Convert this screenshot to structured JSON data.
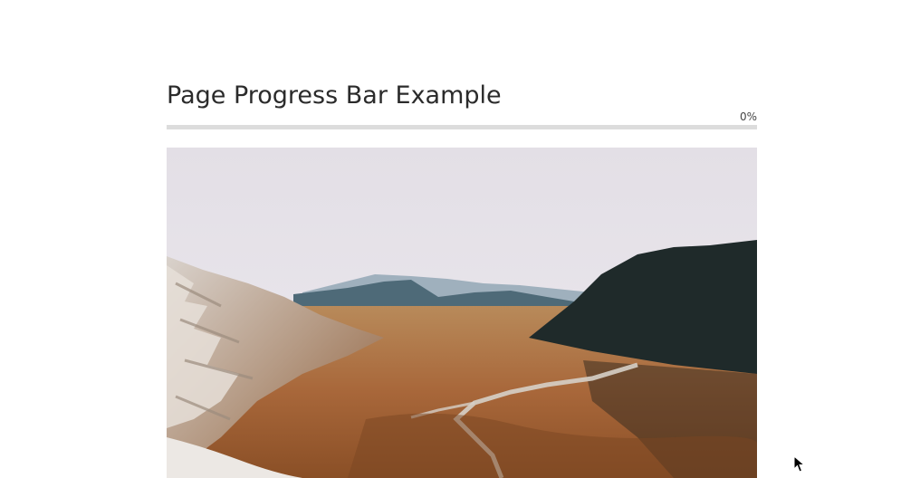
{
  "page": {
    "title": "Page Progress Bar Example"
  },
  "progress": {
    "label": "0%",
    "value": 0,
    "fill_color": "#4a90d9",
    "track_color": "#dcdcdc"
  },
  "hero": {
    "subject": "mountain valley landscape photo"
  },
  "cursor": {
    "icon": "arrow-cursor-icon"
  }
}
